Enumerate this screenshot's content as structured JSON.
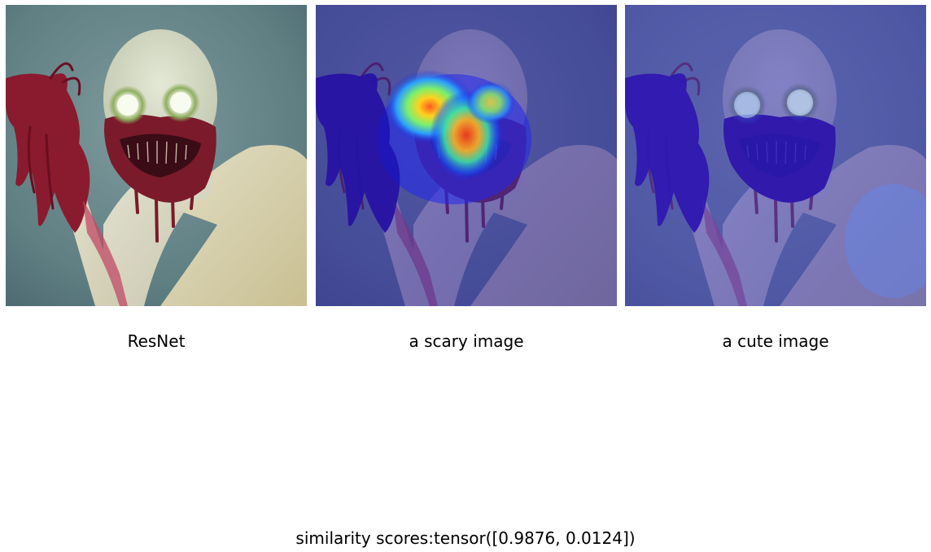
{
  "panels": [
    {
      "label": "ResNet",
      "image": "original-painting",
      "overlay": "none"
    },
    {
      "label": "a scary image",
      "image": "saliency-heatmap-scary",
      "overlay": "jet-heatmap"
    },
    {
      "label": "a cute image",
      "image": "saliency-heatmap-cute",
      "overlay": "blue-tint"
    }
  ],
  "footer": "similarity scores:tensor([0.9876, 0.0124])"
}
